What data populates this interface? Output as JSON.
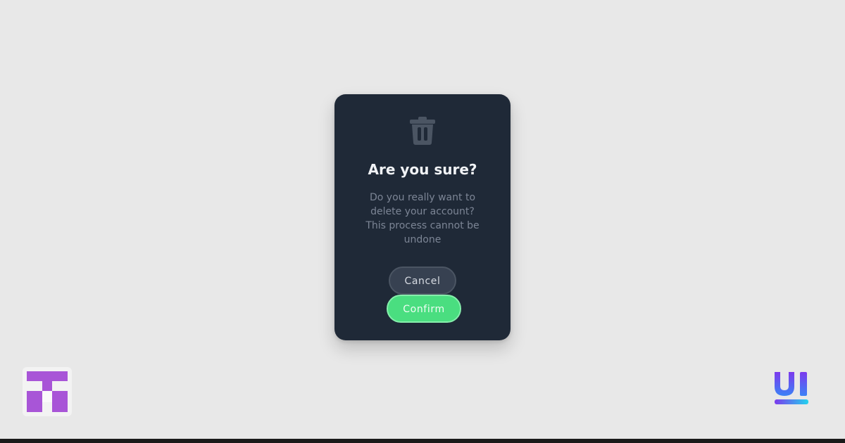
{
  "dialog": {
    "icon": "trash-icon",
    "title": "Are you sure?",
    "message": "Do you really want to delete your account? This process cannot be undone",
    "cancel_label": "Cancel",
    "confirm_label": "Confirm"
  },
  "colors": {
    "page_background": "#e8e8e8",
    "dialog_background": "#1f2937",
    "icon": "#4b5563",
    "confirm": "#4ade80",
    "cancel": "#374151",
    "brand_left": "#a855d7",
    "brand_right_top": "#7c3aed",
    "brand_right_bottom": "#3b82f6"
  },
  "logos": {
    "left": "tuts-logo",
    "right": "uiverse-logo"
  }
}
